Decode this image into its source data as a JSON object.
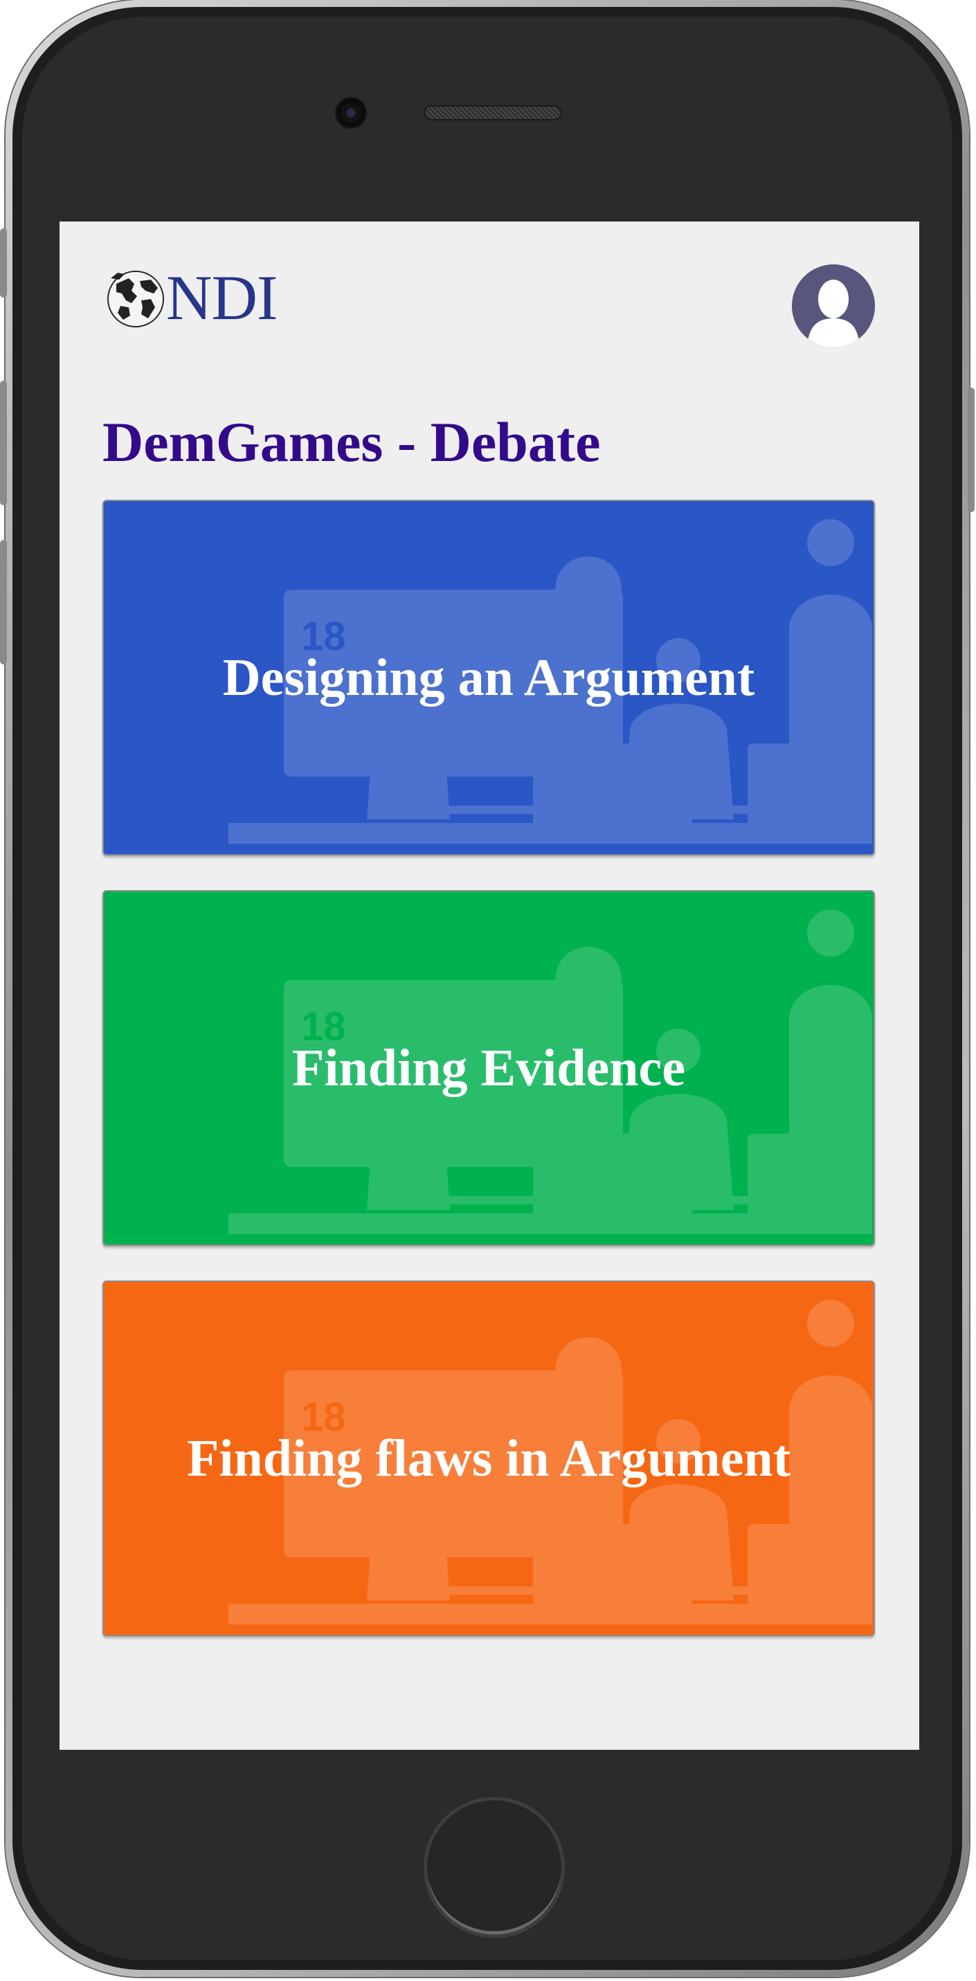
{
  "app": {
    "logo_text": "NDI",
    "logo_icon": "globe-icon",
    "avatar_icon": "user-avatar-icon"
  },
  "page": {
    "title": "DemGames - Debate"
  },
  "cards": [
    {
      "label": "Designing an Argument",
      "color": "#2a56c6",
      "illustration_badge": "18"
    },
    {
      "label": "Finding Evidence",
      "color": "#00b14f",
      "illustration_badge": "18"
    },
    {
      "label": "Finding flaws in Argument",
      "color": "#f66714",
      "illustration_badge": "18"
    }
  ],
  "colors": {
    "title": "#330a8a",
    "logo": "#27358a",
    "screen_bg": "#efefef",
    "avatar_bg": "#57577d"
  }
}
